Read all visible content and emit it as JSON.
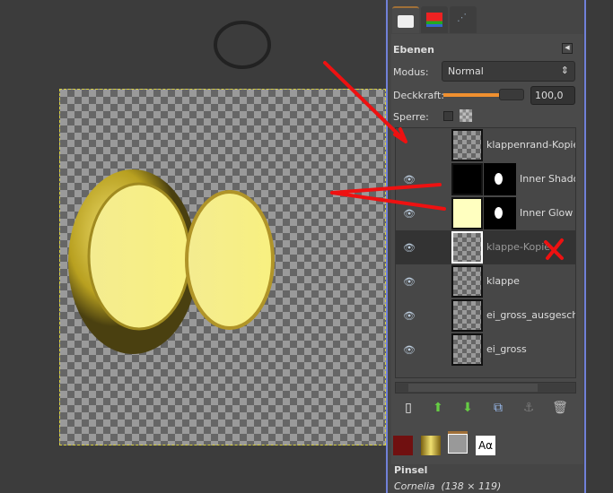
{
  "panel": {
    "title": "Ebenen",
    "mode_label": "Modus:",
    "mode_value": "Normal",
    "opacity_label": "Deckkraft:",
    "opacity_value": "100,0",
    "opacity_percent": 100,
    "lock_label": "Sperre:"
  },
  "layers": [
    {
      "name": "klappenrand-Kopie",
      "visible": false,
      "mask": false
    },
    {
      "name": "Inner Shadow",
      "visible": true,
      "mask": true
    },
    {
      "name": "Inner Glow",
      "visible": true,
      "mask": true
    },
    {
      "name": "klappe-Kopie",
      "visible": true,
      "mask": false,
      "selected": true
    },
    {
      "name": "klappe",
      "visible": true,
      "mask": false
    },
    {
      "name": "ei_gross_ausgeschnitten",
      "visible": true,
      "mask": false
    },
    {
      "name": "ei_gross",
      "visible": true,
      "mask": false
    }
  ],
  "brushes": {
    "title": "Pinsel",
    "current": "Cornelia  (138 × 119)",
    "text_tab": "Aα"
  },
  "colors": {
    "accent": "#f09030",
    "frame": "#7080d8",
    "annotation": "#ee1111"
  }
}
